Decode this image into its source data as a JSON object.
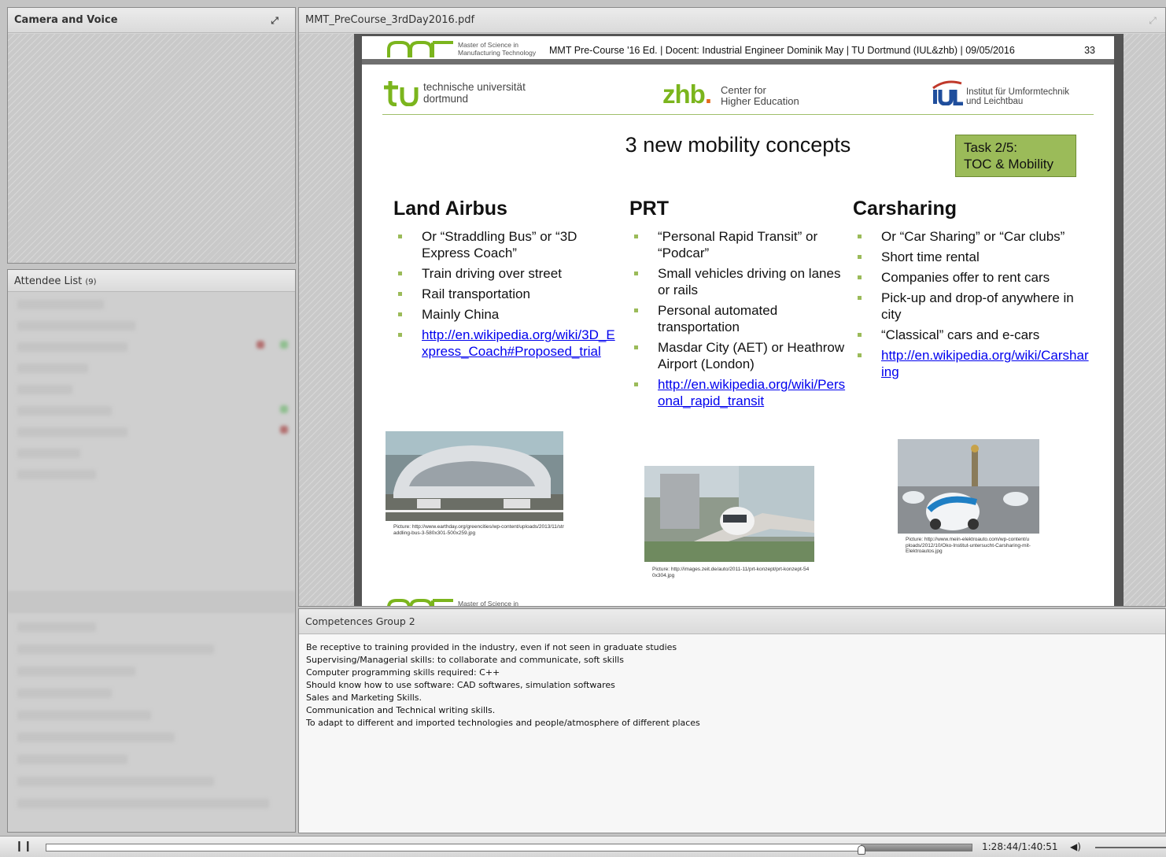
{
  "camera_pod": {
    "title": "Camera and Voice",
    "maximize_icon": "maximize-icon"
  },
  "attendee_pod": {
    "title": "Attendee List",
    "count": "(9)"
  },
  "share_pod": {
    "title": "MMT_PreCourse_3rdDay2016.pdf",
    "maximize_icon": "maximize-icon",
    "slide": {
      "mmt_subtitle_line1": "Master of Science in",
      "mmt_subtitle_line2": "Manufacturing Technology",
      "header_text": "MMT Pre-Course '16 Ed. | Docent: Industrial Engineer Dominik May | TU Dortmund (IUL&zhb) | 09/05/2016",
      "page_number": "33",
      "tu_line1": "technische universität",
      "tu_line2": "dortmund",
      "zhb_letters": "zhb",
      "zhb_dot": ".",
      "zhb_line1": "Center for",
      "zhb_line2": "Higher Education",
      "iul_line1": "Institut für Umformtechnik",
      "iul_line2": "und Leichtbau",
      "title": "3 new mobility concepts",
      "task_line1": "Task 2/5:",
      "task_line2": "TOC & Mobility",
      "columns": [
        {
          "heading": "Land Airbus",
          "items": [
            "Or “Straddling Bus” or “3D Express Coach”",
            "Train driving over street",
            "Rail transportation",
            "Mainly China",
            "http://en.wikipedia.org/wiki/3D_Express_Coach#Proposed_trial"
          ],
          "caption": "Picture: http://www.earthday.org/greencities/wp-content/uploads/2013/11/straddling-bus-3-580x301-500x259.jpg"
        },
        {
          "heading": "PRT",
          "items": [
            "“Personal Rapid Transit” or “Podcar”",
            "Small vehicles driving on lanes or rails",
            "Personal automated transportation",
            "Masdar City (AET) or Heathrow Airport (London)",
            "http://en.wikipedia.org/wiki/Personal_rapid_transit"
          ],
          "caption": "Picture: http://images.zeit.de/auto/2011-11/prt-konzept/prt-konzept-540x304.jpg"
        },
        {
          "heading": "Carsharing",
          "items": [
            "Or “Car Sharing” or “Car clubs”",
            "Short time rental",
            "Companies offer to rent cars",
            "Pick-up and drop-of anywhere in city",
            "“Classical” cars and e-cars",
            "http://en.wikipedia.org/wiki/Carsharing"
          ],
          "caption": "Picture: http://www.mein-elektroauto.com/wp-content/uploads/2012/10/Oko-Institut-untersucht-Carsharing-mit-Elektroautos.jpg"
        }
      ],
      "footer_subtitle": "Master of Science in"
    }
  },
  "competences_pod": {
    "title": "Competences Group 2",
    "lines": [
      "Be receptive to training provided in the industry, even if not seen in graduate studies",
      "Supervising/Managerial skills: to collaborate and communicate, soft skills",
      "Computer programming skills required: C++",
      "Should know how to use software: CAD softwares, simulation softwares",
      "Sales and Marketing Skills.",
      "Communication and Technical writing skills.",
      "To adapt to different and imported technologies and people/atmosphere of different places"
    ]
  },
  "playback": {
    "play_icon": "pause-icon",
    "time": "1:28:44/1:40:51",
    "progress": 0.88,
    "volume_icon": "speaker-icon"
  },
  "colors": {
    "accent_green": "#9bbb59",
    "link": "#0000ee",
    "zhb_green": "#7bb51d",
    "zhb_orange": "#e46a1b"
  }
}
